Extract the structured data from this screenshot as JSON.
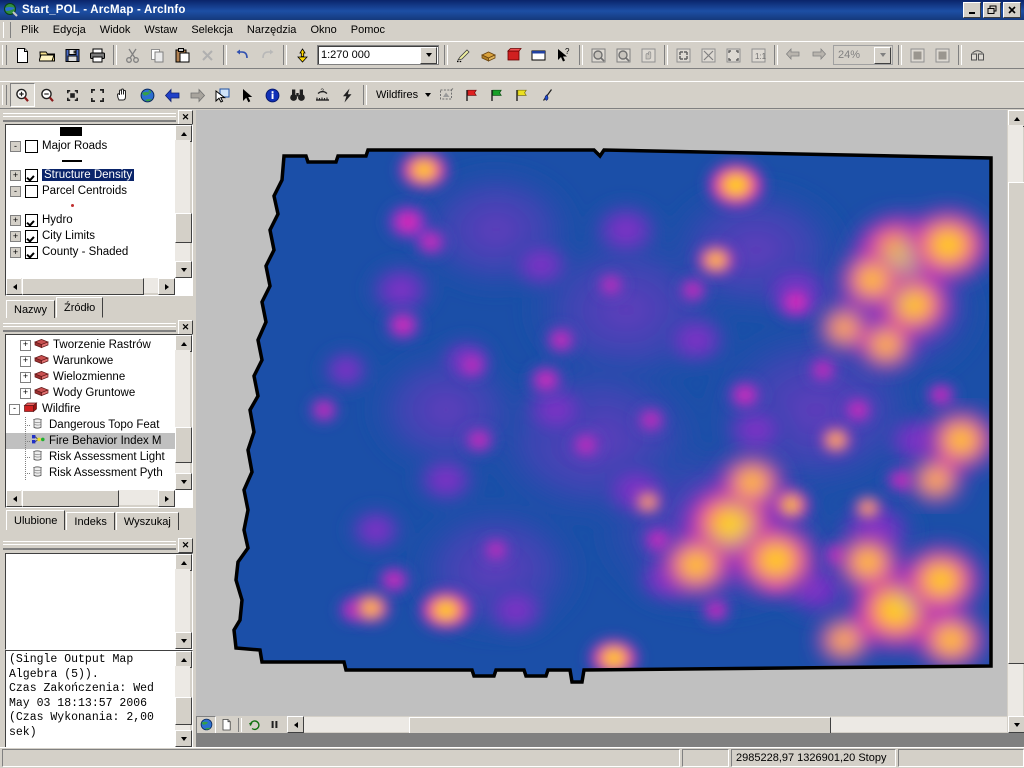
{
  "window": {
    "title": "Start_POL - ArcMap - ArcInfo",
    "icon": "arcmap-globe-icon",
    "buttons": {
      "minimize": "_",
      "restore": "❐",
      "close": "✕"
    }
  },
  "menu": {
    "items": [
      {
        "label": "Plik",
        "accel": "P"
      },
      {
        "label": "Edycja",
        "accel": "E"
      },
      {
        "label": "Widok",
        "accel": "W"
      },
      {
        "label": "Wstaw",
        "accel": "a"
      },
      {
        "label": "Selekcja",
        "accel": "S"
      },
      {
        "label": "Narzędzia",
        "accel": "N"
      },
      {
        "label": "Okno",
        "accel": "O"
      },
      {
        "label": "Pomoc",
        "accel": "m"
      }
    ]
  },
  "toolbars": {
    "standard": {
      "scale_value": "1:270 000",
      "items": [
        "new-document-icon",
        "open-folder-icon",
        "save-icon",
        "print-icon",
        "cut-icon",
        "copy-icon",
        "paste-icon",
        "delete-icon",
        "undo-icon",
        "redo-icon",
        "add-data-icon",
        "editor-toolbar-icon",
        "arctoolbox-icon",
        "model-builder-icon",
        "command-line-icon",
        "whats-this-help-icon"
      ]
    },
    "tools": {
      "dropdown_label": "Wildfires",
      "items": [
        "zoom-in-icon",
        "zoom-out-icon",
        "fixed-zoom-in-icon",
        "fixed-zoom-out-icon",
        "pan-hand-icon",
        "full-extent-globe-icon",
        "back-extent-icon",
        "forward-extent-icon",
        "select-features-icon",
        "select-elements-icon",
        "identify-info-icon",
        "find-binoculars-icon",
        "measure-icon",
        "hyperlink-lightning-icon",
        "wildfires-menu-icon",
        "red-flag-icon",
        "green-flag-icon",
        "yellow-flag-icon",
        "water-drop-icon"
      ]
    },
    "layout": {
      "zoom_value": "24%",
      "enabled": false,
      "items": [
        "layout-zoom-in-icon",
        "layout-zoom-out-icon",
        "layout-pan-icon",
        "zoom-whole-page-icon",
        "zoom-page-width-icon",
        "zoom-to-extent-icon",
        "zoom-100-percent-icon",
        "go-back-extent-icon",
        "go-forward-extent-icon",
        "toggle-draft-mode-icon",
        "focus-data-frame-icon",
        "change-layout-icon"
      ]
    }
  },
  "toc": {
    "panel_close": "✕",
    "top_symbol": "black-filled-swatch",
    "layers": [
      {
        "name": "Major Roads",
        "checked": false,
        "expander": "-",
        "selected": false,
        "symbol": "line-black"
      },
      {
        "name": "Structure Density",
        "checked": true,
        "expander": "+",
        "selected": true,
        "symbol": null
      },
      {
        "name": "Parcel Centroids",
        "checked": false,
        "expander": "-",
        "selected": false,
        "symbol": "dot-red"
      },
      {
        "name": "Hydro",
        "checked": true,
        "expander": "+",
        "selected": false,
        "symbol": null
      },
      {
        "name": "City Limits",
        "checked": true,
        "expander": "+",
        "selected": false,
        "symbol": null
      },
      {
        "name": "County - Shaded",
        "checked": true,
        "expander": "+",
        "selected": false,
        "symbol": null
      }
    ],
    "tabs": [
      {
        "label": "Nazwy",
        "active": false
      },
      {
        "label": "Źródło",
        "active": true
      }
    ]
  },
  "toolbox": {
    "panel_close": "✕",
    "nodes": [
      {
        "label": "Tworzenie Rastrów",
        "expander": "+",
        "icon": "toolbox-icon",
        "depth": 1,
        "selected": false
      },
      {
        "label": "Warunkowe",
        "expander": "+",
        "icon": "toolbox-icon",
        "depth": 1,
        "selected": false
      },
      {
        "label": "Wielozmienne",
        "expander": "+",
        "icon": "toolbox-icon",
        "depth": 1,
        "selected": false
      },
      {
        "label": "Wody Gruntowe",
        "expander": "+",
        "icon": "toolbox-icon",
        "depth": 1,
        "selected": false
      },
      {
        "label": "Wildfire",
        "expander": "-",
        "icon": "toolbox-red-icon",
        "depth": 0,
        "selected": false
      },
      {
        "label": "Dangerous Topo Feat",
        "expander": "",
        "icon": "script-tool-icon",
        "depth": 2,
        "selected": false
      },
      {
        "label": "Fire Behavior Index M",
        "expander": "",
        "icon": "model-tool-icon",
        "depth": 2,
        "selected": true
      },
      {
        "label": "Risk Assessment Light",
        "expander": "",
        "icon": "script-tool-icon",
        "depth": 2,
        "selected": false
      },
      {
        "label": "Risk Assessment Pyth",
        "expander": "",
        "icon": "script-tool-icon",
        "depth": 2,
        "selected": false
      }
    ],
    "tabs": [
      {
        "label": "Ulubione",
        "active": true
      },
      {
        "label": "Indeks",
        "active": false
      },
      {
        "label": "Wyszukaj",
        "active": false
      }
    ]
  },
  "results": {
    "panel_close": "✕",
    "content": ""
  },
  "log": {
    "text": "(Single Output Map\nAlgebra (5)).\nCzas Zakończenia: Wed\nMay 03 18:13:57 2006\n(Czas Wykonania: 2,00\nsek)"
  },
  "mapview": {
    "background": "#c0c0c0",
    "controls": [
      {
        "name": "data-view-button",
        "icon": "globe-icon",
        "active": true
      },
      {
        "name": "layout-view-button",
        "icon": "page-icon",
        "active": false
      },
      {
        "name": "refresh-button",
        "icon": "refresh-icon",
        "active": false
      },
      {
        "name": "pause-drawing-button",
        "icon": "pause-icon",
        "active": false
      }
    ],
    "raster": {
      "name": "Structure Density",
      "color_ramp": [
        "#1b4fa8",
        "#3b3fc0",
        "#7b2ecb",
        "#b51fc9",
        "#ee20b0",
        "#ff3d6e",
        "#ff8a1e",
        "#ffd400",
        "#ffef4a"
      ],
      "boundary_color": "#000000"
    }
  },
  "statusbar": {
    "coordinates": "2985228,97  1326901,20 Stopy"
  }
}
